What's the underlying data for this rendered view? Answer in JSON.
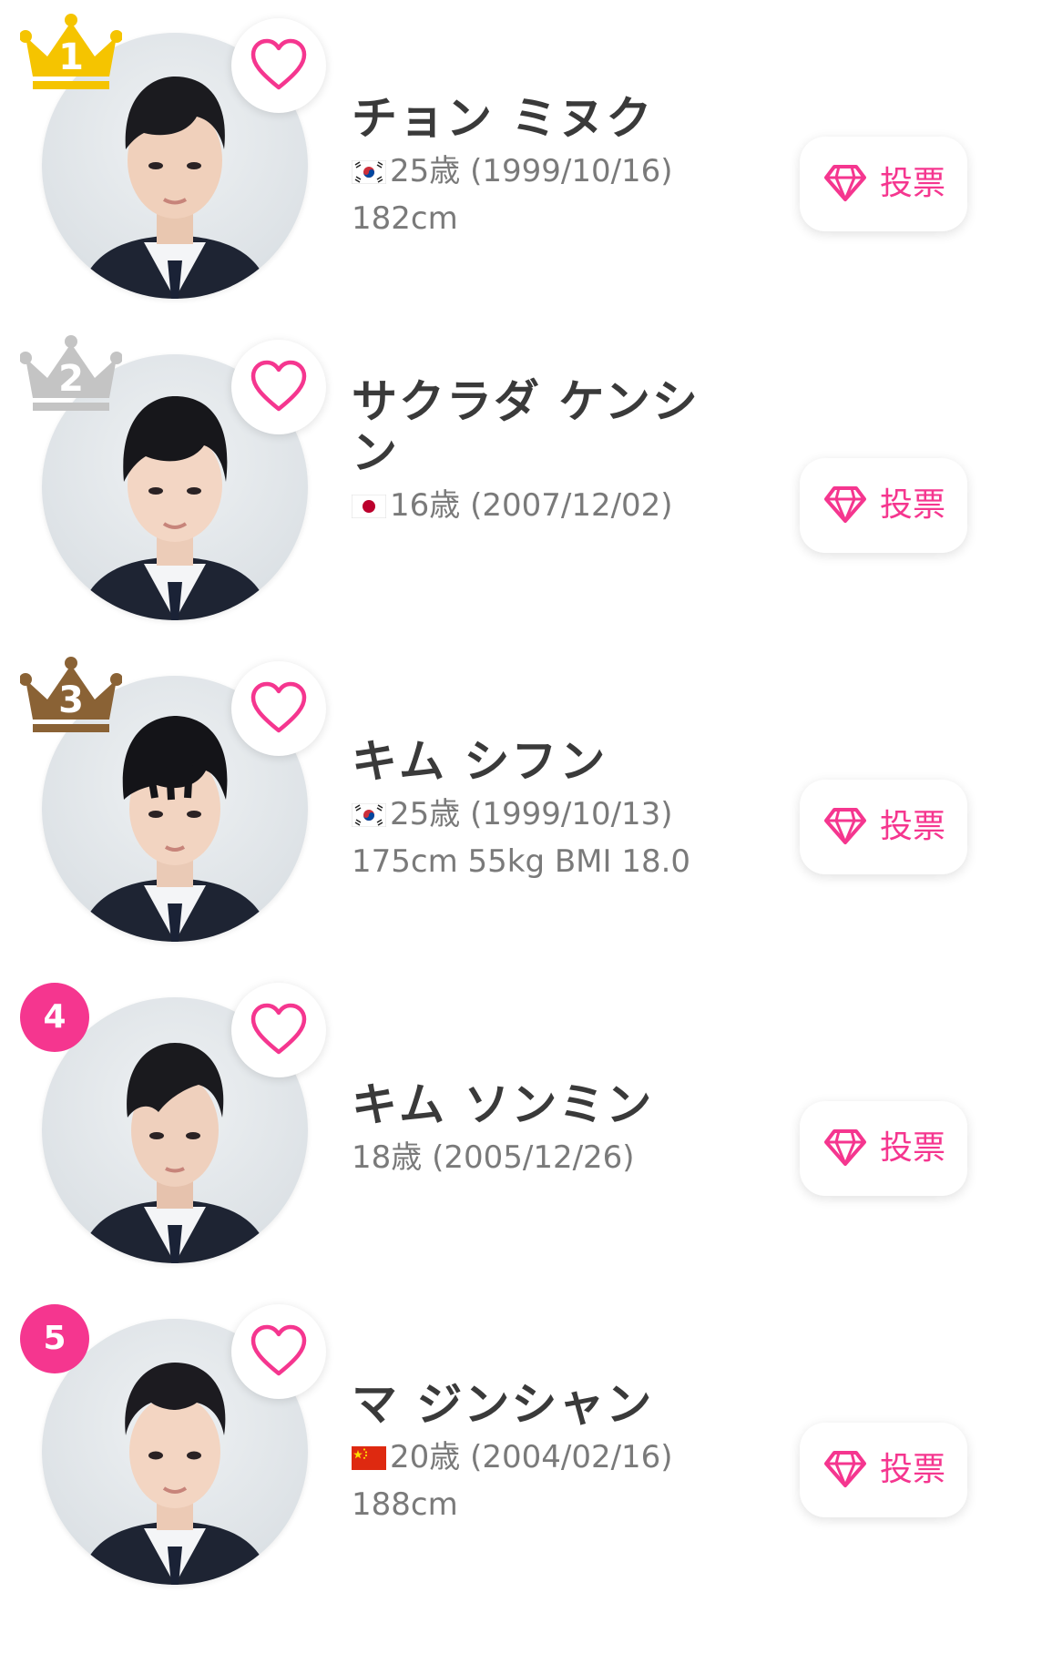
{
  "colors": {
    "accent": "#f5368f",
    "gold": "#f5c400",
    "silver": "#c4c4c4",
    "bronze": "#8a6235",
    "name_text": "#3a3a3a",
    "meta_text": "#7a7a7a"
  },
  "vote_label": "投票",
  "candidates": [
    {
      "rank": "1",
      "rank_style": "gold-crown",
      "name": "チョン ミヌク",
      "flag": "korea-flag-icon",
      "age_birth": "25歳 (1999/10/16)",
      "stats": "182cm"
    },
    {
      "rank": "2",
      "rank_style": "silver-crown",
      "name": "サクラダ ケンシン",
      "flag": "japan-flag-icon",
      "age_birth": "16歳 (2007/12/02)",
      "stats": ""
    },
    {
      "rank": "3",
      "rank_style": "bronze-crown",
      "name": "キム シフン",
      "flag": "korea-flag-icon",
      "age_birth": "25歳 (1999/10/13)",
      "stats": "175cm 55kg BMI 18.0"
    },
    {
      "rank": "4",
      "rank_style": "pink-circle",
      "name": "キム ソンミン",
      "flag": "",
      "age_birth": "18歳 (2005/12/26)",
      "stats": ""
    },
    {
      "rank": "5",
      "rank_style": "pink-circle",
      "name": "マ ジンシャン",
      "flag": "china-flag-icon",
      "age_birth": "20歳 (2004/02/16)",
      "stats": "188cm"
    }
  ]
}
